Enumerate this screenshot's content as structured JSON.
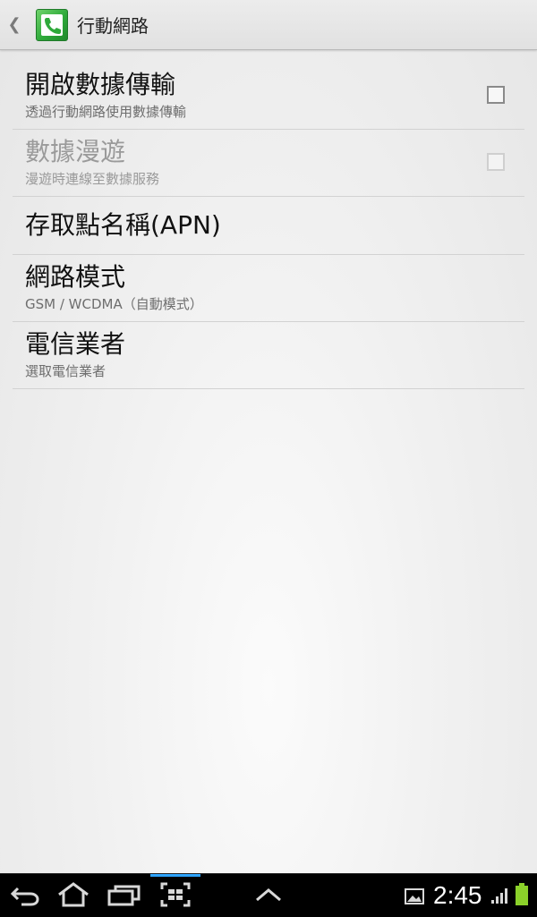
{
  "header": {
    "title": "行動網路",
    "up_icon": "chevron-left-icon",
    "app_icon": "phone-icon"
  },
  "settings": [
    {
      "title": "開啟數據傳輸",
      "summary": "透過行動網路使用數據傳輸",
      "has_checkbox": true,
      "checked": false,
      "enabled": true
    },
    {
      "title": "數據漫遊",
      "summary": "漫遊時連線至數據服務",
      "has_checkbox": true,
      "checked": false,
      "enabled": false
    },
    {
      "title": "存取點名稱(APN)",
      "summary": "",
      "has_checkbox": false,
      "enabled": true
    },
    {
      "title": "網路模式",
      "summary": "GSM / WCDMA（自動模式）",
      "has_checkbox": false,
      "enabled": true
    },
    {
      "title": "電信業者",
      "summary": "選取電信業者",
      "has_checkbox": false,
      "enabled": true
    }
  ],
  "nav": {
    "buttons": [
      "back-icon",
      "home-icon",
      "recent-apps-icon",
      "screenshot-icon",
      "menu-up-icon"
    ]
  },
  "status": {
    "time": "2:45",
    "icons": [
      "gallery-notification-icon",
      "signal-icon",
      "battery-icon"
    ]
  },
  "colors": {
    "accent": "#2ea3ff",
    "icon_green": "#2ea93a",
    "battery": "#8bd12a"
  }
}
